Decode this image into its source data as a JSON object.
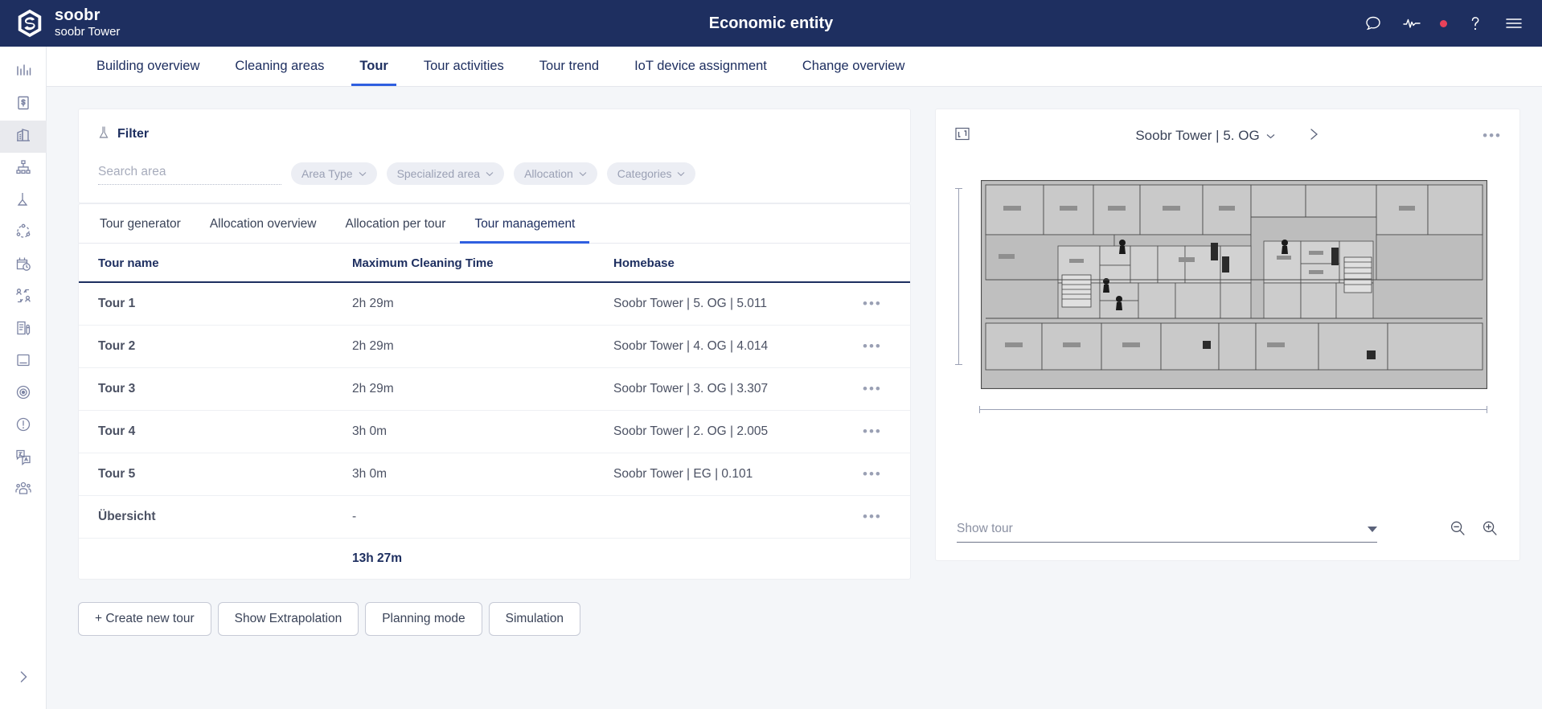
{
  "topbar": {
    "brand_name": "soobr",
    "brand_sub": "soobr Tower",
    "title": "Economic entity",
    "icons": [
      "chat-icon",
      "activity-icon",
      "status-dot",
      "help-icon",
      "hamburger-menu-icon"
    ]
  },
  "rail": {
    "items": [
      {
        "name": "bar-chart-icon"
      },
      {
        "name": "cost-document-icon"
      },
      {
        "name": "building-icon",
        "active": true
      },
      {
        "name": "hierarchy-icon"
      },
      {
        "name": "funnel-icon"
      },
      {
        "name": "network-nodes-icon"
      },
      {
        "name": "calendar-clock-icon"
      },
      {
        "name": "user-swap-icon"
      },
      {
        "name": "document-check-icon"
      },
      {
        "name": "card-icon"
      },
      {
        "name": "target-icon"
      },
      {
        "name": "alert-circle-icon"
      },
      {
        "name": "translate-icon"
      },
      {
        "name": "people-icon"
      }
    ],
    "expand_label": "expand-rail-icon"
  },
  "nav": {
    "tabs": [
      {
        "label": "Building overview",
        "active": false
      },
      {
        "label": "Cleaning areas",
        "active": false
      },
      {
        "label": "Tour",
        "active": true
      },
      {
        "label": "Tour activities",
        "active": false
      },
      {
        "label": "Tour trend",
        "active": false
      },
      {
        "label": "IoT device assignment",
        "active": false
      },
      {
        "label": "Change overview",
        "active": false
      }
    ]
  },
  "filter": {
    "title": "Filter",
    "search_placeholder": "Search area",
    "search_value": "",
    "chips": [
      {
        "label": "Area Type"
      },
      {
        "label": "Specialized area"
      },
      {
        "label": "Allocation"
      },
      {
        "label": "Categories"
      }
    ]
  },
  "subtabs": [
    {
      "label": "Tour generator",
      "active": false
    },
    {
      "label": "Allocation overview",
      "active": false
    },
    {
      "label": "Allocation per tour",
      "active": false
    },
    {
      "label": "Tour management",
      "active": true
    }
  ],
  "table": {
    "columns": [
      "Tour name",
      "Maximum Cleaning Time",
      "Homebase"
    ],
    "rows": [
      {
        "name": "Tour 1",
        "time": "2h 29m",
        "homebase": "Soobr Tower | 5. OG | 5.011",
        "menu": "•••"
      },
      {
        "name": "Tour 2",
        "time": "2h 29m",
        "homebase": "Soobr Tower | 4. OG | 4.014",
        "menu": "•••"
      },
      {
        "name": "Tour 3",
        "time": "2h 29m",
        "homebase": "Soobr Tower | 3. OG | 3.307",
        "menu": "•••"
      },
      {
        "name": "Tour 4",
        "time": "3h 0m",
        "homebase": "Soobr Tower | 2. OG | 2.005",
        "menu": "•••"
      },
      {
        "name": "Tour 5",
        "time": "3h 0m",
        "homebase": "Soobr Tower | EG | 0.101",
        "menu": "•••"
      },
      {
        "name": "Übersicht",
        "time": "-",
        "homebase": "",
        "menu": "•••"
      }
    ],
    "total": "13h 27m"
  },
  "actions": [
    {
      "label": "+ Create new tour"
    },
    {
      "label": "Show Extrapolation"
    },
    {
      "label": "Planning mode"
    },
    {
      "label": "Simulation"
    }
  ],
  "map": {
    "fullscreen_icon": "fullscreen-icon",
    "title": "Soobr Tower | 5. OG",
    "next_label": "›",
    "menu": "•••",
    "select_label": "Show tour",
    "zoom_out": "zoom-out-icon",
    "zoom_in": "zoom-in-icon"
  },
  "colors": {
    "navy": "#1e2f60",
    "accent_blue": "#2f5fe0",
    "status_red": "#e8425a",
    "page_bg": "#f4f6f9"
  }
}
